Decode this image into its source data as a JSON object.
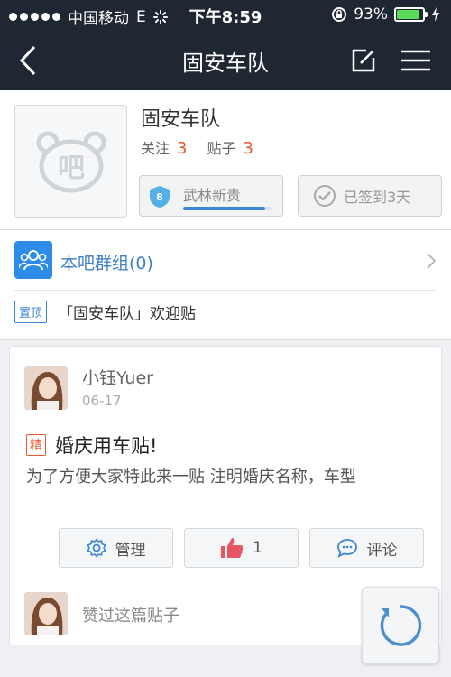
{
  "status_bar": {
    "carrier": "中国移动",
    "network": "E",
    "time": "下午8:59",
    "battery": "93%",
    "battery_level": 0.93
  },
  "nav": {
    "title": "固安车队",
    "back_icon": "chevron-left-icon",
    "edit_icon": "compose-icon",
    "menu_icon": "hamburger-menu-icon"
  },
  "header": {
    "bar_name": "固安车队",
    "follow_label": "关注",
    "follow_count": "3",
    "posts_label": "贴子",
    "posts_count": "3",
    "level": {
      "number": "8",
      "title": "武林新贵",
      "progress": 0.93
    },
    "signin_label": "已签到3天"
  },
  "group": {
    "label": "本吧群组(0)"
  },
  "top_post": {
    "tag": "置顶",
    "title": "「固安车队」欢迎贴"
  },
  "post": {
    "username": "小钰Yuer",
    "date": "06-17",
    "tag": "精",
    "title": "婚庆用车贴!",
    "body": "为了方便大家特此来一贴 注明婚庆名称，车型",
    "actions": {
      "manage_label": "管理",
      "like_count": "1",
      "comment_label": "评论"
    },
    "liked_by_text": "赞过这篇贴子"
  },
  "colors": {
    "nav_bg": "#1f2733",
    "accent_blue": "#3a87d8",
    "accent_orange": "#e8562a"
  }
}
